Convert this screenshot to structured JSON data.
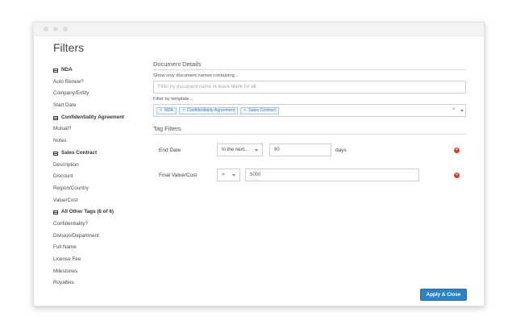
{
  "title": "Filters",
  "sidebar": {
    "groups": [
      {
        "label": "NDA",
        "items": [
          "Auto Renew?",
          "Company/Entity",
          "Start Date"
        ]
      },
      {
        "label": "Confidentiality Agreement",
        "items": [
          "Mutual?",
          "Notes"
        ]
      },
      {
        "label": "Sales Contract",
        "items": [
          "Description",
          "Discount",
          "Region/Country",
          "Value/Cost"
        ]
      },
      {
        "label": "All Other Tags (6 of 6)",
        "items": [
          "Confidentiality?",
          "Division/Department",
          "Full Name",
          "License Fee",
          "Milestones",
          "Royalties"
        ]
      }
    ]
  },
  "document_details": {
    "heading": "Document Details",
    "name_label": "Show only document names containing...",
    "name_placeholder": "Filter by document name or leave blank for all",
    "template_label": "Filter by template...",
    "templates": [
      "NDA",
      "Confidentiality Agreement",
      "Sales Contract"
    ],
    "clear_symbol": "×"
  },
  "tag_filters": {
    "heading": "Tag Filters",
    "rows": [
      {
        "label": "End Date",
        "operator": "In the next...",
        "value": "90",
        "unit": "days"
      },
      {
        "label": "Final Value/Cost",
        "operator": ">",
        "value": "5000",
        "unit": ""
      }
    ]
  },
  "apply_button": "Apply & Close",
  "icons": {
    "group": "table-icon",
    "remove": "remove-circle-icon",
    "tag_remove": "×"
  },
  "colors": {
    "accent": "#2f81c6",
    "tag_bg": "#eef5fb",
    "tag_border": "#a9c8e2",
    "remove": "#d9382b"
  }
}
